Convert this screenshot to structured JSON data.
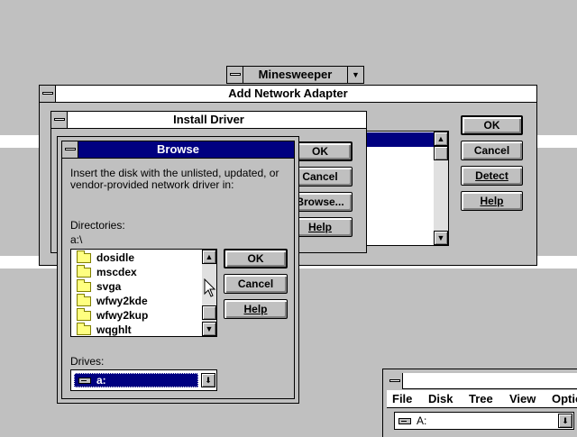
{
  "desktop": {
    "minesweeper_title": "Minesweeper"
  },
  "add_network_adapter": {
    "title": "Add Network Adapter",
    "buttons": {
      "ok": "OK",
      "cancel": "Cancel",
      "detect": "Detect",
      "help": "Help"
    }
  },
  "install_driver": {
    "title": "Install Driver",
    "buttons": {
      "ok": "OK",
      "cancel": "Cancel",
      "browse": "Browse...",
      "help": "Help"
    }
  },
  "browse": {
    "title": "Browse",
    "message": "Insert the disk with the unlisted, updated, or vendor-provided network driver in:",
    "directories_label": "Directories:",
    "current_path": "a:\\",
    "folders": [
      "dosidle",
      "mscdex",
      "svga",
      "wfwy2kde",
      "wfwy2kup",
      "wqghlt"
    ],
    "drives_label": "Drives:",
    "drive_selected": "a:",
    "buttons": {
      "ok": "OK",
      "cancel": "Cancel",
      "help": "Help"
    }
  },
  "file_manager": {
    "menu": [
      "File",
      "Disk",
      "Tree",
      "View",
      "Optio"
    ],
    "drive_value": "A:"
  }
}
